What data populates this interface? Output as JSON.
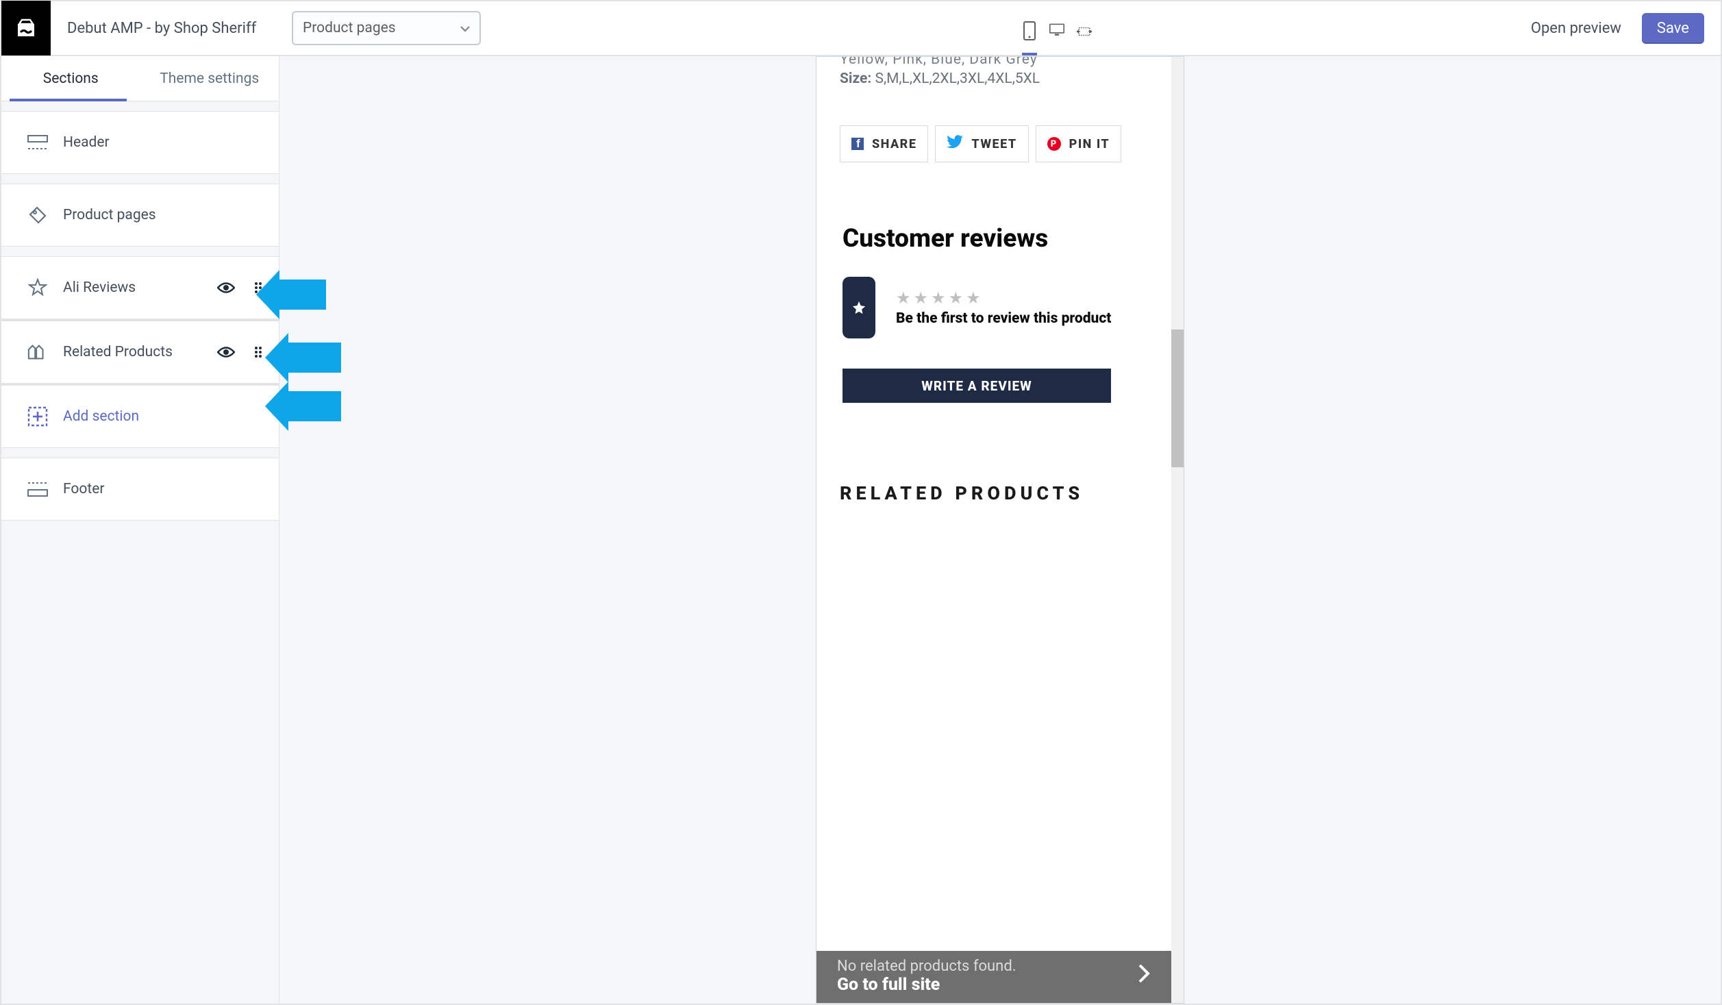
{
  "topbar": {
    "title": "Debut AMP - by Shop Sheriff",
    "select_value": "Product pages",
    "open_preview": "Open preview",
    "save": "Save"
  },
  "sidebar": {
    "tabs": {
      "sections": "Sections",
      "theme_settings": "Theme settings"
    },
    "items": {
      "header": "Header",
      "product_pages": "Product pages",
      "ali_reviews": "Ali Reviews",
      "related_products": "Related Products",
      "add_section": "Add section",
      "footer": "Footer"
    }
  },
  "preview": {
    "colors_cutoff": "Yellow, Pink, Blue, Dark Grey",
    "size_label": "Size:",
    "size_value": "S,M,L,XL,2XL,3XL,4XL,5XL",
    "share": {
      "share": "SHARE",
      "tweet": "TWEET",
      "pin": "PIN IT"
    },
    "reviews": {
      "title": "Customer reviews",
      "first_review": "Be the first to review this product",
      "write_review": "WRITE A REVIEW"
    },
    "related": {
      "heading": "RELATED PRODUCTS",
      "none": "No related products found.",
      "go_full": "Go to full site"
    }
  },
  "colors": {
    "accent": "#5c6ac4",
    "arrow_blue": "#0ea5e9",
    "dark_navy": "#1f2a44"
  }
}
